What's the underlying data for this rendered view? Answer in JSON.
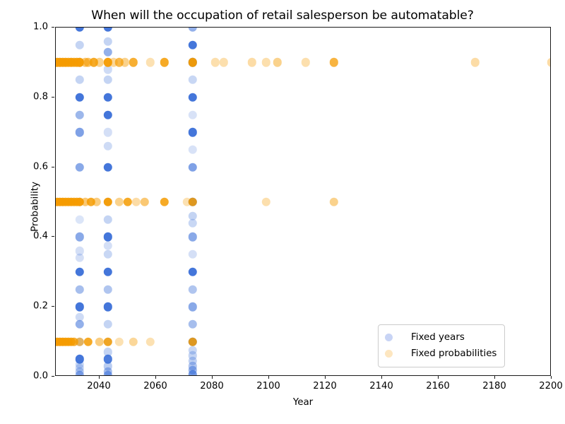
{
  "chart_data": {
    "type": "scatter",
    "title": "When will the occupation of retail salesperson be automatable?",
    "xlabel": "Year",
    "ylabel": "Probability",
    "xlim": [
      2024.5,
      2200
    ],
    "ylim": [
      0.0,
      1.0
    ],
    "grid": false,
    "xticks": [
      2040,
      2060,
      2080,
      2100,
      2120,
      2140,
      2160,
      2180,
      2200
    ],
    "xticklabels": [
      "2040",
      "2060",
      "2080",
      "2100",
      "2120",
      "2140",
      "2160",
      "2180",
      "2200"
    ],
    "yticks": [
      0.0,
      0.2,
      0.4,
      0.6,
      0.8,
      1.0
    ],
    "yticklabels": [
      "0.0",
      "0.2",
      "0.4",
      "0.6",
      "0.8",
      "1.0"
    ],
    "legend": {
      "position": "lower right",
      "entries": [
        {
          "name": "Fixed years",
          "color": "#c8d4f5"
        },
        {
          "name": "Fixed probabilities",
          "color": "#fde6c0"
        }
      ]
    },
    "colors": {
      "fixed_years": "#3a6fd8",
      "fixed_probabilities": "#f59b00",
      "axis": "#1a1a1a",
      "background": "#ffffff"
    },
    "series": [
      {
        "name": "Fixed years",
        "color": "#3a6fd8",
        "marker": "o",
        "points": [
          {
            "x": 2033,
            "y": 1.0,
            "a": 0.95
          },
          {
            "x": 2033,
            "y": 0.95,
            "a": 0.3
          },
          {
            "x": 2033,
            "y": 0.9,
            "a": 0.22
          },
          {
            "x": 2033,
            "y": 0.85,
            "a": 0.3
          },
          {
            "x": 2033,
            "y": 0.8,
            "a": 0.95
          },
          {
            "x": 2033,
            "y": 0.75,
            "a": 0.5
          },
          {
            "x": 2033,
            "y": 0.7,
            "a": 0.65
          },
          {
            "x": 2033,
            "y": 0.6,
            "a": 0.6
          },
          {
            "x": 2033,
            "y": 0.5,
            "a": 0.25
          },
          {
            "x": 2033,
            "y": 0.45,
            "a": 0.18
          },
          {
            "x": 2033,
            "y": 0.4,
            "a": 0.6
          },
          {
            "x": 2033,
            "y": 0.36,
            "a": 0.22
          },
          {
            "x": 2033,
            "y": 0.34,
            "a": 0.22
          },
          {
            "x": 2033,
            "y": 0.3,
            "a": 0.95
          },
          {
            "x": 2033,
            "y": 0.25,
            "a": 0.45
          },
          {
            "x": 2033,
            "y": 0.2,
            "a": 0.95
          },
          {
            "x": 2033,
            "y": 0.17,
            "a": 0.25
          },
          {
            "x": 2033,
            "y": 0.15,
            "a": 0.55
          },
          {
            "x": 2033,
            "y": 0.1,
            "a": 0.3
          },
          {
            "x": 2033,
            "y": 0.05,
            "a": 0.95
          },
          {
            "x": 2033,
            "y": 0.035,
            "a": 0.28
          },
          {
            "x": 2033,
            "y": 0.025,
            "a": 0.28
          },
          {
            "x": 2033,
            "y": 0.015,
            "a": 0.35
          },
          {
            "x": 2033,
            "y": 0.005,
            "a": 0.55
          },
          {
            "x": 2043,
            "y": 1.0,
            "a": 0.95
          },
          {
            "x": 2043,
            "y": 0.96,
            "a": 0.3
          },
          {
            "x": 2043,
            "y": 0.93,
            "a": 0.55
          },
          {
            "x": 2043,
            "y": 0.88,
            "a": 0.25
          },
          {
            "x": 2043,
            "y": 0.85,
            "a": 0.3
          },
          {
            "x": 2043,
            "y": 0.8,
            "a": 0.95
          },
          {
            "x": 2043,
            "y": 0.75,
            "a": 0.95
          },
          {
            "x": 2043,
            "y": 0.7,
            "a": 0.22
          },
          {
            "x": 2043,
            "y": 0.66,
            "a": 0.25
          },
          {
            "x": 2043,
            "y": 0.6,
            "a": 0.95
          },
          {
            "x": 2043,
            "y": 0.5,
            "a": 0.3
          },
          {
            "x": 2043,
            "y": 0.45,
            "a": 0.3
          },
          {
            "x": 2043,
            "y": 0.4,
            "a": 0.95
          },
          {
            "x": 2043,
            "y": 0.375,
            "a": 0.22
          },
          {
            "x": 2043,
            "y": 0.35,
            "a": 0.28
          },
          {
            "x": 2043,
            "y": 0.3,
            "a": 0.95
          },
          {
            "x": 2043,
            "y": 0.25,
            "a": 0.4
          },
          {
            "x": 2043,
            "y": 0.2,
            "a": 0.95
          },
          {
            "x": 2043,
            "y": 0.15,
            "a": 0.3
          },
          {
            "x": 2043,
            "y": 0.1,
            "a": 0.25
          },
          {
            "x": 2043,
            "y": 0.07,
            "a": 0.3
          },
          {
            "x": 2043,
            "y": 0.05,
            "a": 0.9
          },
          {
            "x": 2043,
            "y": 0.03,
            "a": 0.35
          },
          {
            "x": 2043,
            "y": 0.015,
            "a": 0.45
          },
          {
            "x": 2043,
            "y": 0.005,
            "a": 0.6
          },
          {
            "x": 2073,
            "y": 1.0,
            "a": 0.55
          },
          {
            "x": 2073,
            "y": 0.95,
            "a": 0.95
          },
          {
            "x": 2073,
            "y": 0.9,
            "a": 0.95
          },
          {
            "x": 2073,
            "y": 0.85,
            "a": 0.28
          },
          {
            "x": 2073,
            "y": 0.8,
            "a": 0.95
          },
          {
            "x": 2073,
            "y": 0.75,
            "a": 0.2
          },
          {
            "x": 2073,
            "y": 0.7,
            "a": 0.95
          },
          {
            "x": 2073,
            "y": 0.65,
            "a": 0.2
          },
          {
            "x": 2073,
            "y": 0.6,
            "a": 0.65
          },
          {
            "x": 2073,
            "y": 0.5,
            "a": 0.85
          },
          {
            "x": 2073,
            "y": 0.46,
            "a": 0.3
          },
          {
            "x": 2073,
            "y": 0.44,
            "a": 0.28
          },
          {
            "x": 2073,
            "y": 0.4,
            "a": 0.6
          },
          {
            "x": 2073,
            "y": 0.35,
            "a": 0.22
          },
          {
            "x": 2073,
            "y": 0.3,
            "a": 0.95
          },
          {
            "x": 2073,
            "y": 0.25,
            "a": 0.4
          },
          {
            "x": 2073,
            "y": 0.2,
            "a": 0.6
          },
          {
            "x": 2073,
            "y": 0.15,
            "a": 0.45
          },
          {
            "x": 2073,
            "y": 0.1,
            "a": 0.85
          },
          {
            "x": 2073,
            "y": 0.075,
            "a": 0.28
          },
          {
            "x": 2073,
            "y": 0.06,
            "a": 0.3
          },
          {
            "x": 2073,
            "y": 0.045,
            "a": 0.32
          },
          {
            "x": 2073,
            "y": 0.03,
            "a": 0.4
          },
          {
            "x": 2073,
            "y": 0.018,
            "a": 0.5
          },
          {
            "x": 2073,
            "y": 0.006,
            "a": 0.7
          }
        ]
      },
      {
        "name": "Fixed probabilities",
        "color": "#f59b00",
        "marker": "o",
        "points": [
          {
            "x": 2025,
            "y": 0.9,
            "a": 0.95
          },
          {
            "x": 2026,
            "y": 0.9,
            "a": 0.95
          },
          {
            "x": 2027,
            "y": 0.9,
            "a": 0.9
          },
          {
            "x": 2028,
            "y": 0.9,
            "a": 0.9
          },
          {
            "x": 2029,
            "y": 0.9,
            "a": 0.85
          },
          {
            "x": 2030,
            "y": 0.9,
            "a": 0.9
          },
          {
            "x": 2031,
            "y": 0.9,
            "a": 0.8
          },
          {
            "x": 2032,
            "y": 0.9,
            "a": 0.85
          },
          {
            "x": 2033,
            "y": 0.9,
            "a": 0.95
          },
          {
            "x": 2035,
            "y": 0.9,
            "a": 0.55
          },
          {
            "x": 2036,
            "y": 0.9,
            "a": 0.6
          },
          {
            "x": 2038,
            "y": 0.9,
            "a": 0.85
          },
          {
            "x": 2040,
            "y": 0.9,
            "a": 0.45
          },
          {
            "x": 2043,
            "y": 0.9,
            "a": 0.95
          },
          {
            "x": 2045,
            "y": 0.9,
            "a": 0.4
          },
          {
            "x": 2047,
            "y": 0.9,
            "a": 0.7
          },
          {
            "x": 2049,
            "y": 0.9,
            "a": 0.45
          },
          {
            "x": 2052,
            "y": 0.9,
            "a": 0.8
          },
          {
            "x": 2058,
            "y": 0.9,
            "a": 0.3
          },
          {
            "x": 2063,
            "y": 0.9,
            "a": 0.85
          },
          {
            "x": 2073,
            "y": 0.9,
            "a": 0.95
          },
          {
            "x": 2081,
            "y": 0.9,
            "a": 0.32
          },
          {
            "x": 2084,
            "y": 0.9,
            "a": 0.32
          },
          {
            "x": 2094,
            "y": 0.9,
            "a": 0.35
          },
          {
            "x": 2099,
            "y": 0.9,
            "a": 0.32
          },
          {
            "x": 2103,
            "y": 0.9,
            "a": 0.45
          },
          {
            "x": 2113,
            "y": 0.9,
            "a": 0.32
          },
          {
            "x": 2123,
            "y": 0.9,
            "a": 0.75
          },
          {
            "x": 2173,
            "y": 0.9,
            "a": 0.35
          },
          {
            "x": 2200,
            "y": 0.9,
            "a": 0.35
          },
          {
            "x": 2025,
            "y": 0.5,
            "a": 0.95
          },
          {
            "x": 2026,
            "y": 0.5,
            "a": 0.95
          },
          {
            "x": 2027,
            "y": 0.5,
            "a": 0.95
          },
          {
            "x": 2028,
            "y": 0.5,
            "a": 0.9
          },
          {
            "x": 2029,
            "y": 0.5,
            "a": 0.9
          },
          {
            "x": 2030,
            "y": 0.5,
            "a": 0.9
          },
          {
            "x": 2031,
            "y": 0.5,
            "a": 0.85
          },
          {
            "x": 2032,
            "y": 0.5,
            "a": 0.85
          },
          {
            "x": 2033,
            "y": 0.5,
            "a": 0.95
          },
          {
            "x": 2035,
            "y": 0.5,
            "a": 0.55
          },
          {
            "x": 2037,
            "y": 0.5,
            "a": 0.85
          },
          {
            "x": 2039,
            "y": 0.5,
            "a": 0.5
          },
          {
            "x": 2043,
            "y": 0.5,
            "a": 0.95
          },
          {
            "x": 2047,
            "y": 0.5,
            "a": 0.45
          },
          {
            "x": 2050,
            "y": 0.5,
            "a": 0.85
          },
          {
            "x": 2053,
            "y": 0.5,
            "a": 0.35
          },
          {
            "x": 2056,
            "y": 0.5,
            "a": 0.55
          },
          {
            "x": 2063,
            "y": 0.5,
            "a": 0.85
          },
          {
            "x": 2071,
            "y": 0.5,
            "a": 0.3
          },
          {
            "x": 2073,
            "y": 0.5,
            "a": 0.85
          },
          {
            "x": 2099,
            "y": 0.5,
            "a": 0.32
          },
          {
            "x": 2123,
            "y": 0.5,
            "a": 0.45
          },
          {
            "x": 2025,
            "y": 0.1,
            "a": 0.95
          },
          {
            "x": 2026,
            "y": 0.1,
            "a": 0.95
          },
          {
            "x": 2027,
            "y": 0.1,
            "a": 0.95
          },
          {
            "x": 2028,
            "y": 0.1,
            "a": 0.9
          },
          {
            "x": 2029,
            "y": 0.1,
            "a": 0.9
          },
          {
            "x": 2030,
            "y": 0.1,
            "a": 0.85
          },
          {
            "x": 2031,
            "y": 0.1,
            "a": 0.8
          },
          {
            "x": 2033,
            "y": 0.1,
            "a": 0.6
          },
          {
            "x": 2036,
            "y": 0.1,
            "a": 0.85
          },
          {
            "x": 2040,
            "y": 0.1,
            "a": 0.5
          },
          {
            "x": 2043,
            "y": 0.1,
            "a": 0.85
          },
          {
            "x": 2047,
            "y": 0.1,
            "a": 0.3
          },
          {
            "x": 2052,
            "y": 0.1,
            "a": 0.4
          },
          {
            "x": 2058,
            "y": 0.1,
            "a": 0.3
          },
          {
            "x": 2073,
            "y": 0.1,
            "a": 0.85
          }
        ]
      }
    ]
  }
}
